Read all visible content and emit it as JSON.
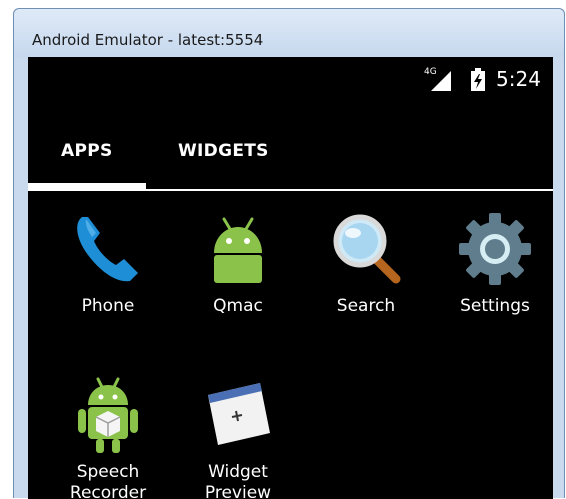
{
  "window": {
    "title": "Android Emulator - latest:5554"
  },
  "status_bar": {
    "network": "4G",
    "time": "5:24"
  },
  "tabs": [
    {
      "label": "APPS",
      "selected": true
    },
    {
      "label": "WIDGETS",
      "selected": false
    }
  ],
  "apps": [
    {
      "label": "Phone",
      "icon": "phone-icon"
    },
    {
      "label": "Qmac",
      "icon": "android-icon"
    },
    {
      "label": "Search",
      "icon": "magnifier-icon"
    },
    {
      "label": "Settings",
      "icon": "gear-icon"
    },
    {
      "label": "Speech\nRecorder",
      "icon": "speech-recorder-icon"
    },
    {
      "label": "Widget\nPreview",
      "icon": "widget-preview-icon"
    }
  ],
  "colors": {
    "screen": "#000000",
    "phone": "#1e8fd6",
    "android": "#8bc34a",
    "settings": "#5f7d8c"
  }
}
